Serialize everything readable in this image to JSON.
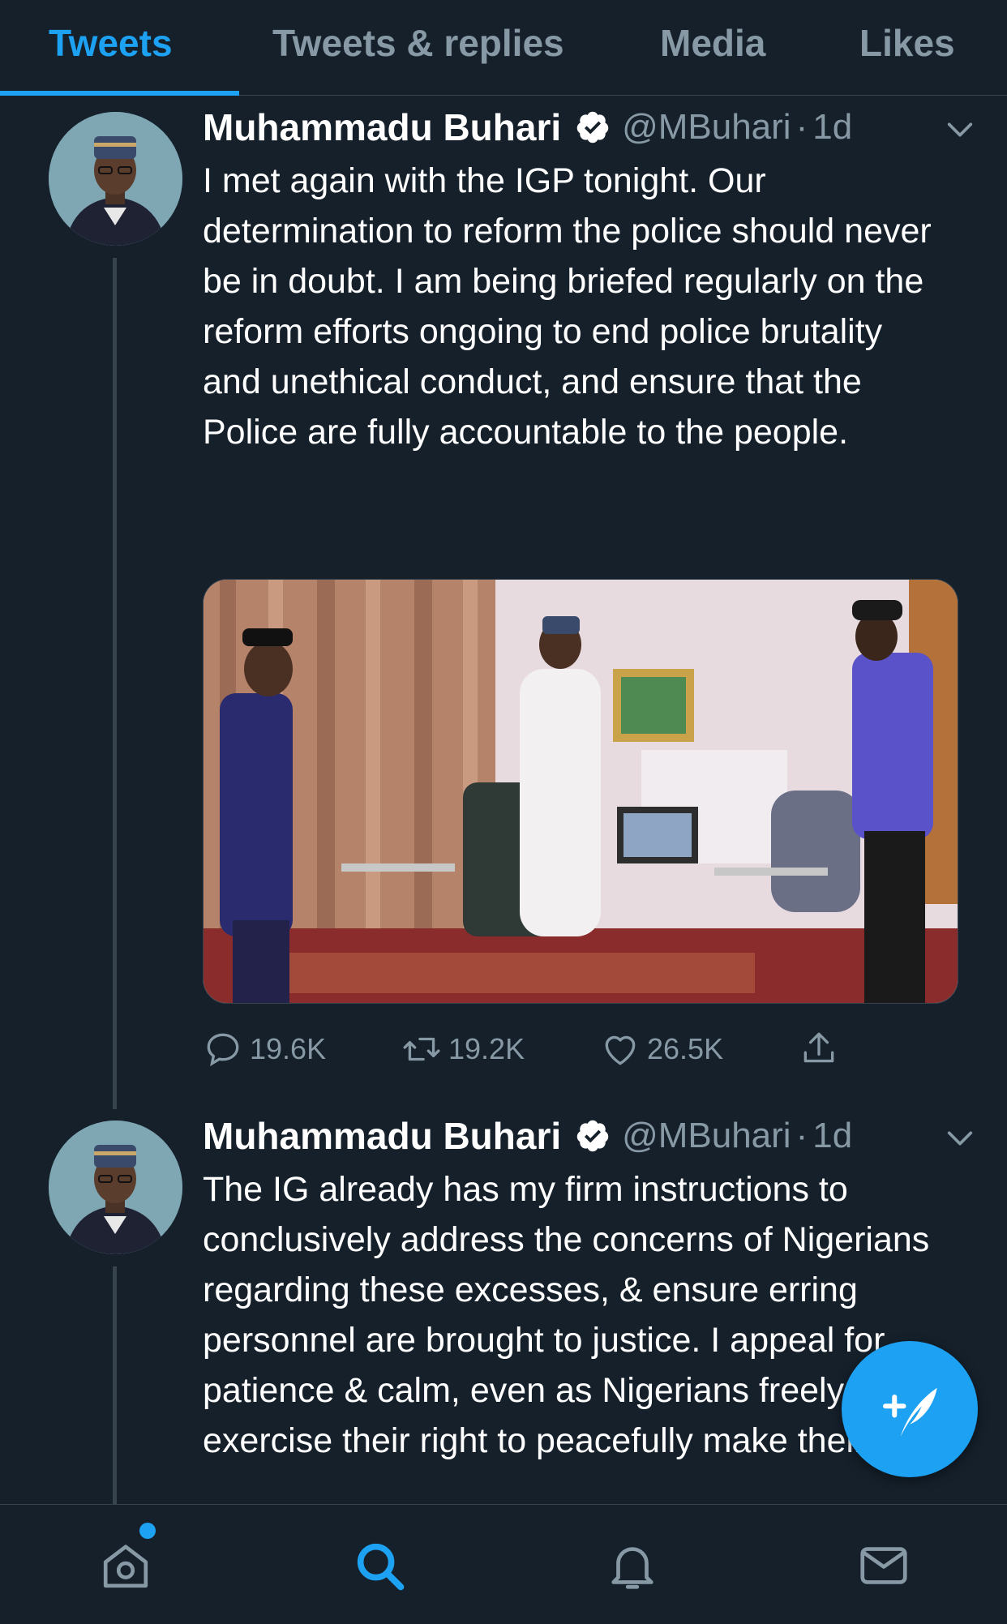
{
  "tabs": [
    {
      "label": "Tweets",
      "active": true
    },
    {
      "label": "Tweets & replies",
      "active": false
    },
    {
      "label": "Media",
      "active": false
    },
    {
      "label": "Likes",
      "active": false
    }
  ],
  "tweets": [
    {
      "name": "Muhammadu Buhari",
      "handle": "@MBuhari",
      "separator": "·",
      "time": "1d",
      "text": "I met again with the IGP tonight. Our determination to reform the police should never be in doubt. I am being briefed regularly on the reform efforts ongoing to end police brutality and unethical conduct, and ensure that the Police are fully accountable to the people.",
      "has_photo": true,
      "replies": "19.6K",
      "retweets": "19.2K",
      "likes": "26.5K"
    },
    {
      "name": "Muhammadu Buhari",
      "handle": "@MBuhari",
      "separator": "·",
      "time": "1d",
      "text": "The IG already has my firm instructions to conclusively address the concerns of Nigerians regarding these excesses, & ensure erring personnel are brought to justice. I appeal for patience & calm, even as Nigerians freely exercise their right to peacefully make their views"
    }
  ],
  "icons": {
    "verified": "verified-badge-icon",
    "caret": "chevron-down-icon",
    "reply": "comment-icon",
    "retweet": "retweet-icon",
    "like": "heart-icon",
    "share": "share-icon",
    "compose": "compose-tweet-icon",
    "nav": [
      "home-icon",
      "search-icon",
      "notifications-icon",
      "messages-icon"
    ]
  },
  "colors": {
    "background": "#15202b",
    "accent": "#1da1f2",
    "secondary_text": "#8899a6",
    "divider": "#38444d"
  }
}
